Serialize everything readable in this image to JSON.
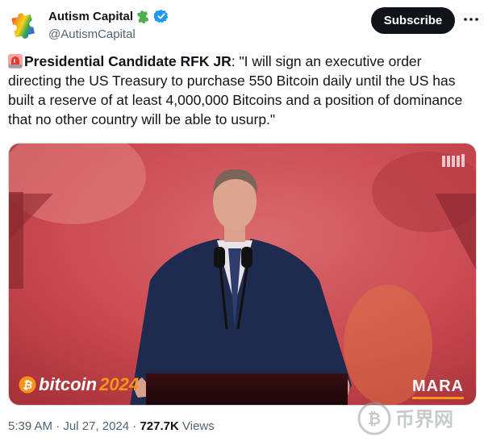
{
  "author": {
    "display_name": "Autism Capital",
    "handle": "@AutismCapital",
    "verified": true
  },
  "actions": {
    "subscribe_label": "Subscribe"
  },
  "tweet": {
    "lead": "Presidential Candidate RFK JR",
    "quote": ": \"I will sign an executive order directing the US Treasury to purchase 550 Bitcoin daily until the US has built a reserve of at least 4,000,000 Bitcoins and a position of dominance that no other country will be able to usurp.\""
  },
  "media": {
    "event_logo_word": "bitcoin",
    "event_logo_year": "2024",
    "sponsor_logo": "MARA"
  },
  "meta": {
    "time": "5:39 AM",
    "date": "Jul 27, 2024",
    "sep": " · ",
    "views_count": "727.7K",
    "views_label": "Views"
  },
  "watermark": {
    "text": "币界网"
  },
  "colors": {
    "verified_blue": "#1d9bf0",
    "subscribe_bg": "#0f1419",
    "secondary_text": "#536471",
    "bitcoin_orange": "#f7931a"
  },
  "icons": {
    "avatar": "puzzle-piece-rainbow-icon",
    "name_badge": "puzzle-piece-green-icon",
    "verified": "verified-badge-icon",
    "more": "more-dots-icon",
    "siren": "siren-emoji-icon"
  }
}
